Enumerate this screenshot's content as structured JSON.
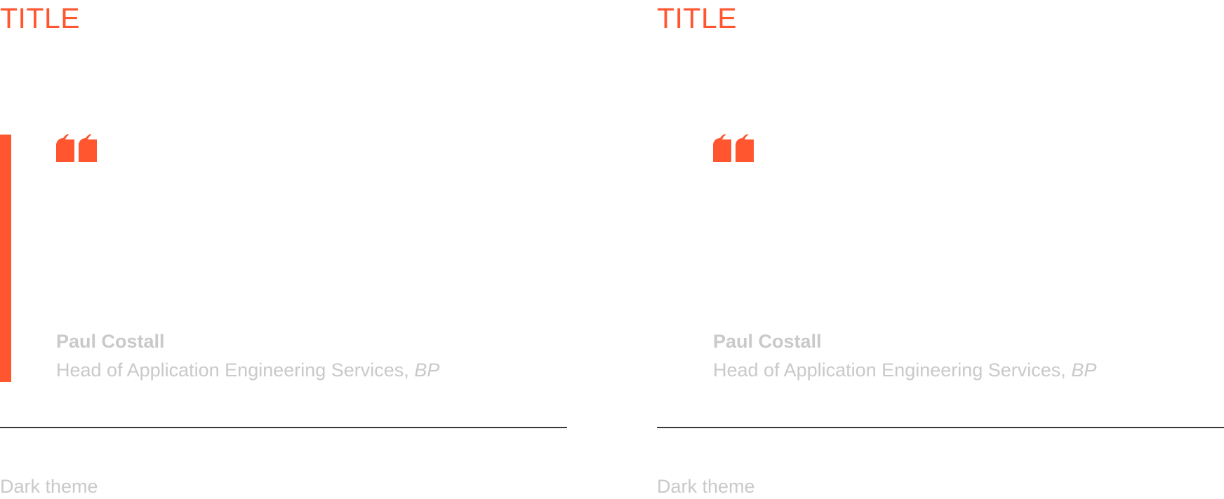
{
  "colors": {
    "accent": "#ff5630",
    "muted_text": "#c9c9c9",
    "divider": "#3a3a3a",
    "background": "#ffffff"
  },
  "panels": [
    {
      "title": "TITLE",
      "has_accent_bar": true,
      "quote_icon": "quote-open-icon",
      "author_name": "Paul Costall",
      "author_role": "Head of Application Engineering Services, ",
      "author_company": "BP",
      "caption": "Dark theme"
    },
    {
      "title": "TITLE",
      "has_accent_bar": false,
      "quote_icon": "quote-open-icon",
      "author_name": "Paul Costall",
      "author_role": "Head of Application Engineering Services, ",
      "author_company": "BP",
      "caption": "Dark theme"
    }
  ]
}
